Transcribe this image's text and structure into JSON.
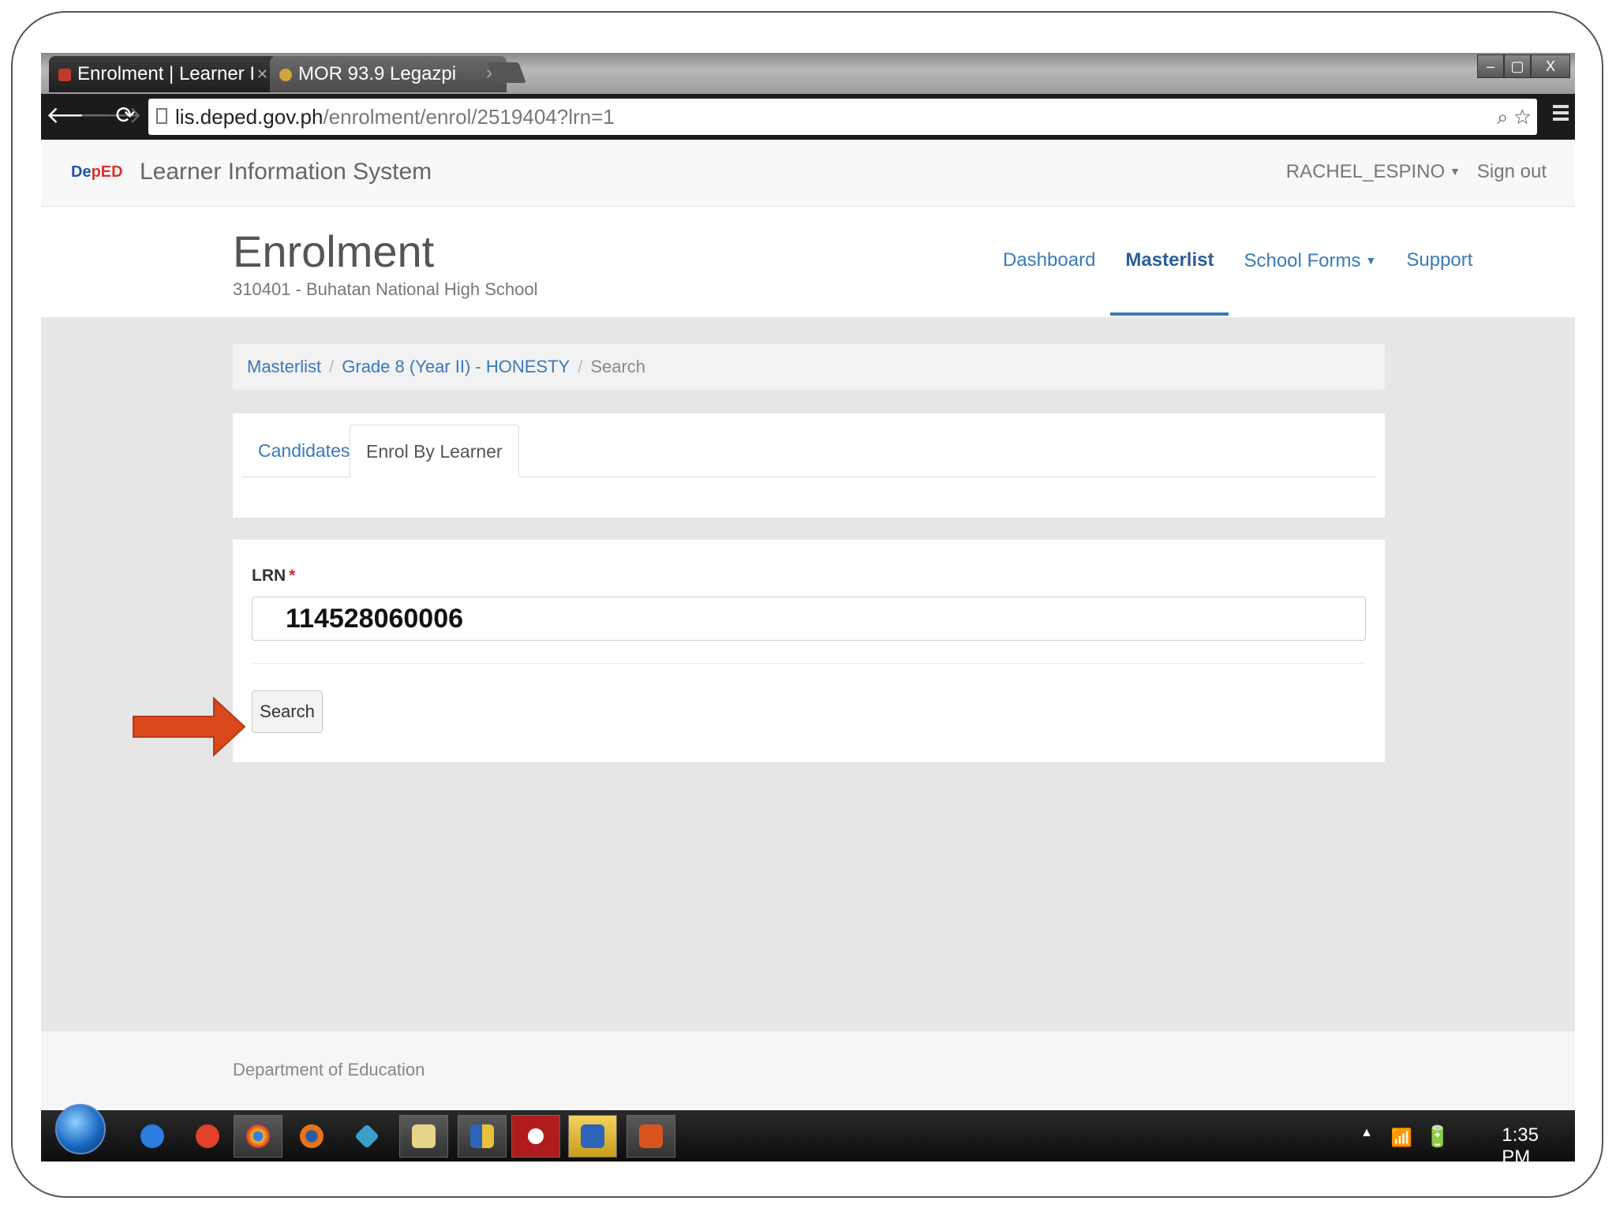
{
  "browser": {
    "tabs": [
      {
        "title": "Enrolment | Learner I",
        "active": true
      },
      {
        "title": "MOR 93.9 Legazpi",
        "active": false
      }
    ],
    "window_controls": {
      "minimize": "–",
      "restore": "▢",
      "close": "X"
    },
    "url_host": "lis.deped.gov.ph",
    "url_path": "/enrolment/enrol/2519404?lrn=1"
  },
  "app": {
    "logo_text_a": "De",
    "logo_text_b": "pED",
    "title": "Learner Information System",
    "user": "RACHEL_ESPINO",
    "signout": "Sign out"
  },
  "page": {
    "title": "Enrolment",
    "subtitle": "310401 - Buhatan National High School",
    "nav": [
      {
        "label": "Dashboard",
        "active": false
      },
      {
        "label": "Masterlist",
        "active": true
      },
      {
        "label": "School Forms",
        "active": false,
        "dropdown": true
      },
      {
        "label": "Support",
        "active": false
      }
    ]
  },
  "breadcrumb": {
    "items": [
      "Masterlist",
      "Grade 8 (Year II) - HONESTY"
    ],
    "current": "Search"
  },
  "tabs": {
    "items": [
      {
        "label": "Candidates",
        "active": false
      },
      {
        "label": "Enrol By Learner",
        "active": true
      }
    ]
  },
  "form": {
    "lrn_label": "LRN",
    "required_mark": "*",
    "lrn_value": "114528060006",
    "search_label": "Search"
  },
  "footer": {
    "text": "Department of Education"
  },
  "taskbar": {
    "clock": "1:35 PM"
  },
  "colors": {
    "link": "#3a7ab8",
    "arrow": "#d9481b",
    "required": "#d9302c"
  }
}
